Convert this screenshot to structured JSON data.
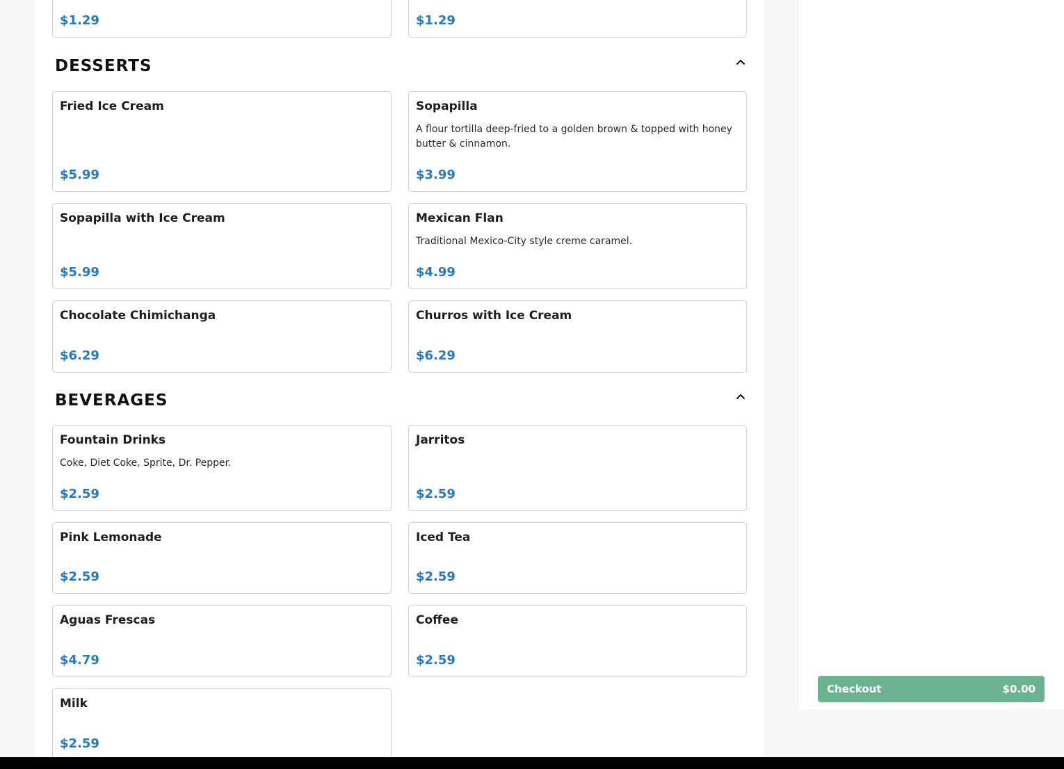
{
  "top_items": [
    {
      "price": "$1.29"
    },
    {
      "price": "$1.29"
    }
  ],
  "categories": [
    {
      "title": "DESSERTS",
      "items": [
        {
          "name": "Fried Ice Cream",
          "description": "",
          "price": "$5.99"
        },
        {
          "name": "Sopapilla",
          "description": "A flour tortilla deep-fried to a golden brown & topped with honey butter & cinnamon.",
          "price": "$3.99"
        },
        {
          "name": "Sopapilla with Ice Cream",
          "description": "",
          "price": "$5.99"
        },
        {
          "name": "Mexican Flan",
          "description": "Traditional Mexico-City style creme caramel.",
          "price": "$4.99"
        },
        {
          "name": "Chocolate Chimichanga",
          "description": "",
          "price": "$6.29"
        },
        {
          "name": "Churros with Ice Cream",
          "description": "",
          "price": "$6.29"
        }
      ]
    },
    {
      "title": "BEVERAGES",
      "items": [
        {
          "name": "Fountain Drinks",
          "description": "Coke, Diet Coke, Sprite, Dr. Pepper.",
          "price": "$2.59"
        },
        {
          "name": "Jarritos",
          "description": "",
          "price": "$2.59"
        },
        {
          "name": "Pink Lemonade",
          "description": "",
          "price": "$2.59"
        },
        {
          "name": "Iced Tea",
          "description": "",
          "price": "$2.59"
        },
        {
          "name": "Aguas Frescas",
          "description": "",
          "price": "$4.79"
        },
        {
          "name": "Coffee",
          "description": "",
          "price": "$2.59"
        },
        {
          "name": "Milk",
          "description": "",
          "price": "$2.59"
        }
      ]
    }
  ],
  "cart": {
    "checkout_label": "Checkout",
    "total": "$0.00"
  },
  "icons": {
    "collapse": "chevron-up-icon"
  },
  "colors": {
    "price": "#2a79bf",
    "checkout": "#6bb38e"
  }
}
